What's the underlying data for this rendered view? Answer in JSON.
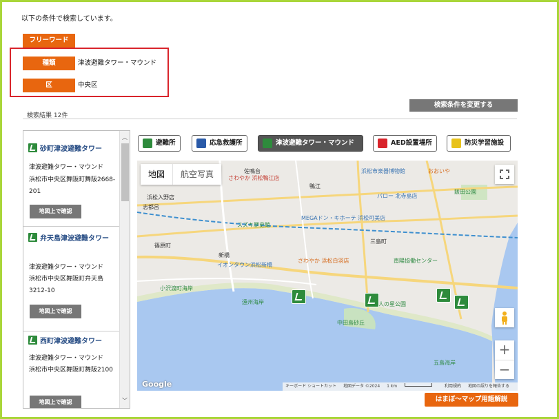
{
  "header": {
    "intro": "以下の条件で検索しています。"
  },
  "conditions": {
    "freeword_label": "フリーワード",
    "type_label": "種類",
    "type_value": "津波避難タワー・マウンド",
    "ward_label": "区",
    "ward_value": "中央区"
  },
  "results": {
    "count": "検索結果 12件",
    "change_button": "検索条件を変更する",
    "items": [
      {
        "title": "砂町津波避難タワー",
        "type": "津波避難タワー・マウンド",
        "address": "浜松市中央区舞阪町舞阪2668-201",
        "map_button": "地図上で確認"
      },
      {
        "title": "弁天島津波避難タワー",
        "type": "津波避難タワー・マウンド",
        "address": "浜松市中央区舞阪町弁天島3212-10",
        "map_button": "地図上で確認"
      },
      {
        "title": "西町津波避難タワー",
        "type": "津波避難タワー・マウンド",
        "address": "浜松市中央区舞阪町舞阪2100",
        "map_button": "地図上で確認"
      }
    ]
  },
  "categories": [
    {
      "label": "避難所",
      "color": "#2e8b3c"
    },
    {
      "label": "応急救護所",
      "color": "#2a5aa8"
    },
    {
      "label": "津波避難タワー・マウンド",
      "color": "#2e8b3c"
    },
    {
      "label": "AED設置場所",
      "color": "#d9242b"
    },
    {
      "label": "防災学習施設",
      "color": "#e8c21a"
    }
  ],
  "map": {
    "tab_map": "地図",
    "tab_aerial": "航空写真",
    "zoom_in": "+",
    "zoom_out": "−",
    "google": "Google",
    "attribution": {
      "shortcuts": "キーボード ショートカット",
      "data": "地図データ ©2024",
      "scale": "1 km",
      "terms": "利用規約",
      "report": "地図の誤りを報告する"
    },
    "labels": {
      "l1": "佐鳴台",
      "l2": "浜松市楽器博物館",
      "l3": "おおいや",
      "l4": "浜松入野店",
      "l5": "志都呂",
      "l6": "パロー 北寺島店",
      "l7": "飯田公園",
      "l8": "MEGAドン・キホーテ 浜松可美店",
      "l9": "スズキ歴史館",
      "l10": "篠原町",
      "l11": "イオンタウン浜松新橋",
      "l12": "さわやか 浜松白羽店",
      "l13": "南陽協働センター",
      "l14": "小沢渡町海岸",
      "l15": "遠州海岸",
      "l16": "人の星公園",
      "l17": "中田島砂丘",
      "l18": "五島海岸",
      "l19": "三島町",
      "l20": "鴨江",
      "l21": "さわやか 浜松鴨江店",
      "l22": "新橋"
    }
  },
  "footer": {
    "guide_button": "はまぼ～マップ用語解説"
  }
}
